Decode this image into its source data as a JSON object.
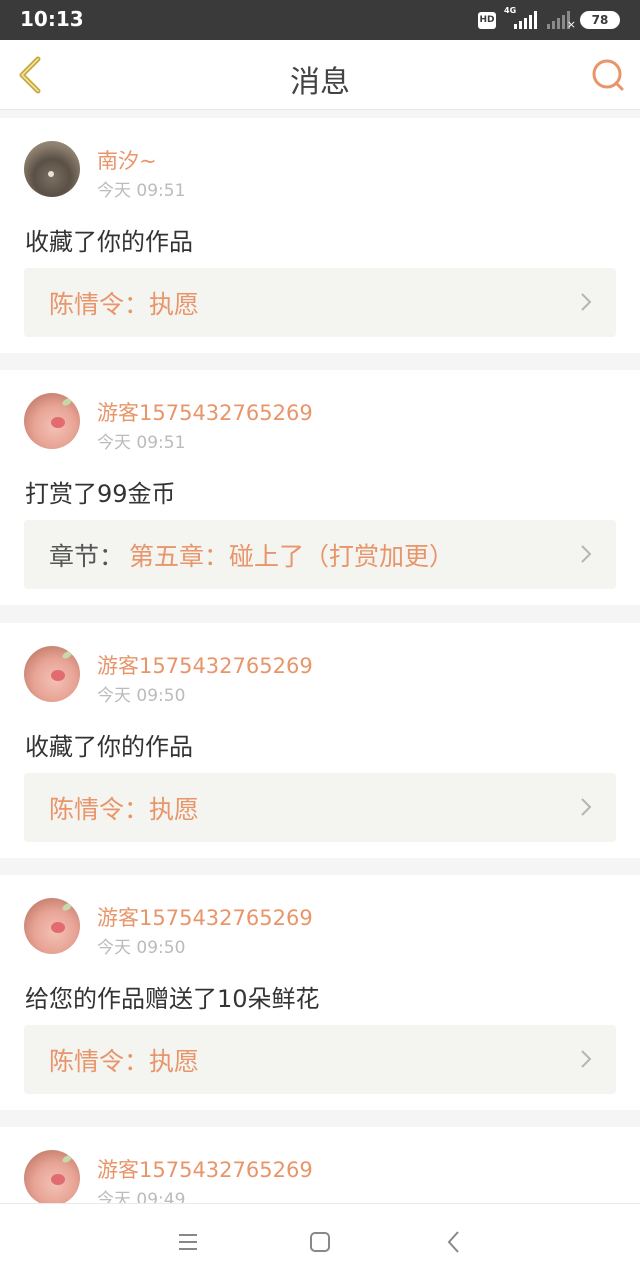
{
  "status_bar": {
    "time": "10:13",
    "hd_label": "HD",
    "network": "4G",
    "battery": "78"
  },
  "header": {
    "title": "消息",
    "back_icon": "chevron-left-icon",
    "search_icon": "search-icon"
  },
  "colors": {
    "accent": "#e8956a",
    "back_icon": "#c6a93d",
    "background": "#f5f5f5",
    "work_box": "#f4f4f1"
  },
  "messages": [
    {
      "user": "南汐~",
      "time": "今天 09:51",
      "action": "收藏了你的作品",
      "work_label": "",
      "work_title": "陈情令：执愿"
    },
    {
      "user": "游客1575432765269",
      "time": "今天 09:51",
      "action": "打赏了99金币",
      "work_label": "章节：",
      "work_title": "第五章：碰上了（打赏加更）"
    },
    {
      "user": "游客1575432765269",
      "time": "今天 09:50",
      "action": "收藏了你的作品",
      "work_label": "",
      "work_title": "陈情令：执愿"
    },
    {
      "user": "游客1575432765269",
      "time": "今天 09:50",
      "action": "给您的作品赠送了10朵鲜花",
      "work_label": "",
      "work_title": "陈情令：执愿"
    },
    {
      "user": "游客1575432765269",
      "time": "今天 09:49",
      "action": "",
      "work_label": "",
      "work_title": ""
    }
  ],
  "nav_bar": {
    "menu_icon": "menu-icon",
    "home_icon": "home-square-icon",
    "back_icon": "back-triangle-icon"
  }
}
